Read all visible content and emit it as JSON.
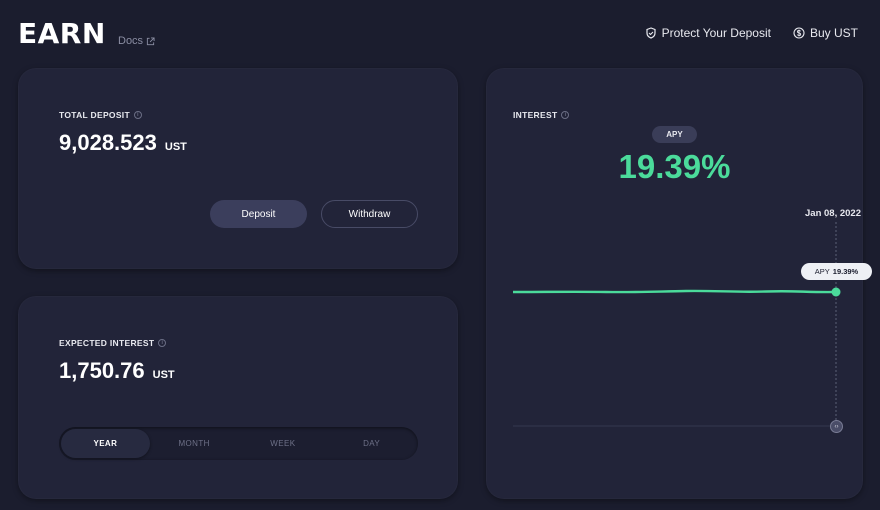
{
  "header": {
    "logo": "EARN",
    "docs_label": "Docs",
    "nav": [
      {
        "label": "Protect Your Deposit",
        "icon": "shield-icon"
      },
      {
        "label": "Buy UST",
        "icon": "dollar-circle-icon"
      }
    ]
  },
  "total_deposit": {
    "title": "TOTAL DEPOSIT",
    "amount": "9,028.523",
    "unit": "UST",
    "deposit_label": "Deposit",
    "withdraw_label": "Withdraw"
  },
  "expected_interest": {
    "title": "EXPECTED INTEREST",
    "amount": "1,750.76",
    "unit": "UST",
    "tabs": [
      "YEAR",
      "MONTH",
      "WEEK",
      "DAY"
    ],
    "active_tab": "YEAR"
  },
  "interest": {
    "title": "INTEREST",
    "apy_label": "APY",
    "apy_value": "19.39%",
    "chart_date": "Jan 08, 2022",
    "tooltip_label": "APY",
    "tooltip_value": "19.39%"
  },
  "colors": {
    "background": "#1b1d2e",
    "card": "#222439",
    "accent_green": "#4bdb9b"
  }
}
